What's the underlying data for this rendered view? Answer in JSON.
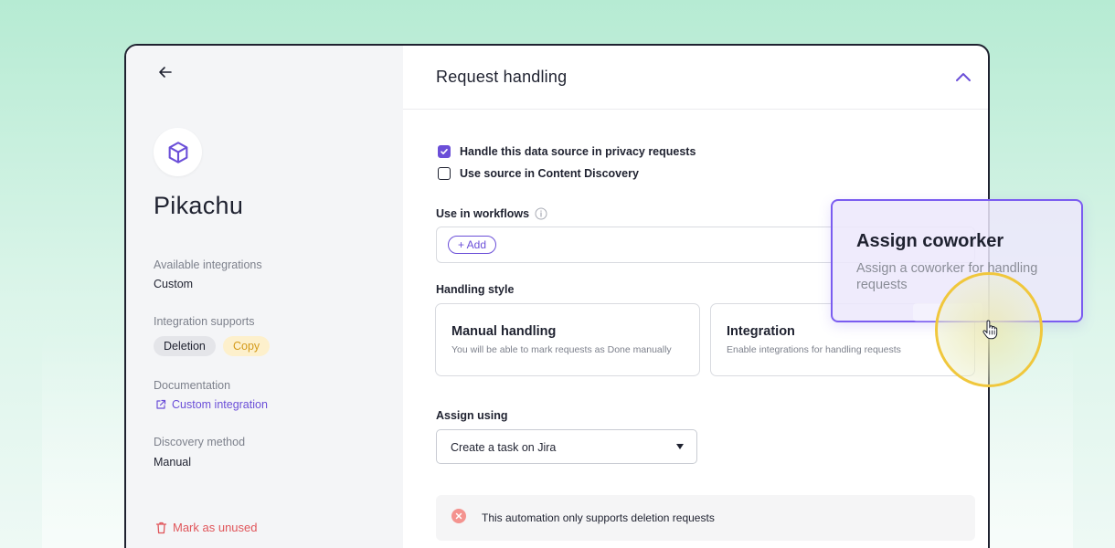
{
  "sidebar": {
    "source_name": "Pikachu",
    "available_integrations_label": "Available integrations",
    "available_integrations_value": "Custom",
    "integration_supports_label": "Integration supports",
    "supports": [
      "Deletion",
      "Copy"
    ],
    "documentation_label": "Documentation",
    "documentation_link": "Custom integration",
    "discovery_method_label": "Discovery method",
    "discovery_method_value": "Manual",
    "mark_unused": "Mark as unused"
  },
  "section": {
    "title": "Request handling",
    "checkbox_privacy": "Handle this data source in privacy requests",
    "checkbox_privacy_checked": true,
    "checkbox_discovery": "Use source in Content Discovery",
    "checkbox_discovery_checked": false,
    "workflows_label": "Use in workflows",
    "add_label": "+ Add",
    "handling_style_label": "Handling style",
    "manual_title": "Manual handling",
    "manual_desc": "You will be able to mark requests as Done manually",
    "integration_title": "Integration",
    "integration_desc": "Enable integrations for handling requests",
    "assign_using_label": "Assign using",
    "assign_using_value": "Create a task on Jira",
    "notice": "This automation only supports deletion requests"
  },
  "popover": {
    "title": "Assign coworker",
    "description": "Assign a coworker for handling requests"
  },
  "colors": {
    "accent": "#6b4fd8",
    "popover_border": "#7a5cf0",
    "highlight_ring": "#f0c73c",
    "danger": "#e0555a",
    "background": "#b6ebd3"
  }
}
